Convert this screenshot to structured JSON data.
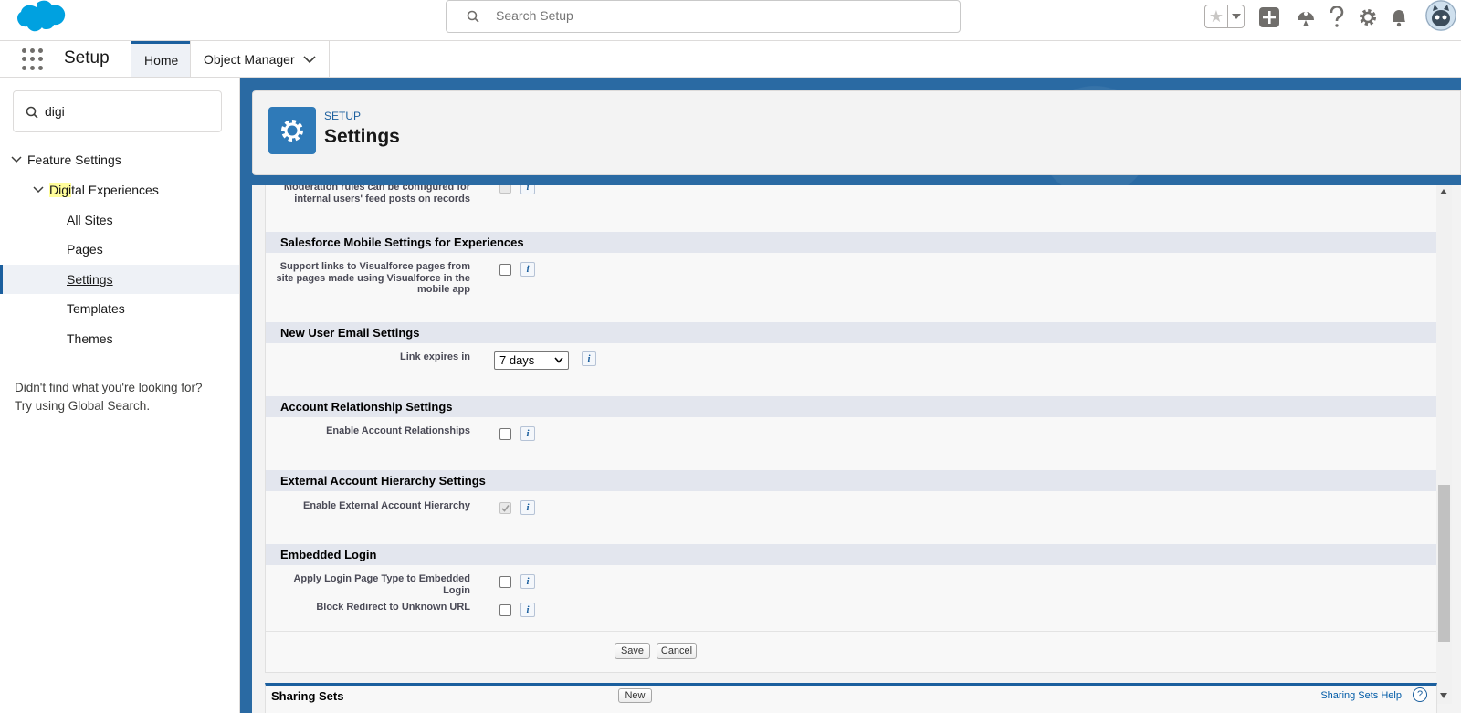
{
  "header": {
    "search_placeholder": "Search Setup"
  },
  "nav": {
    "app_name": "Setup",
    "tabs": [
      {
        "label": "Home",
        "active": true
      },
      {
        "label": "Object Manager",
        "active": false
      }
    ]
  },
  "sidebar": {
    "quickfind_value": "digi",
    "tree": {
      "feature_settings": "Feature Settings",
      "digital_highlight": "Digi",
      "digital_rest": "tal Experiences",
      "children": [
        "All Sites",
        "Pages",
        "Settings",
        "Templates",
        "Themes"
      ],
      "selected": "Settings"
    },
    "help_line1": "Didn't find what you're looking for?",
    "help_line2": "Try using Global Search."
  },
  "page_header": {
    "eyebrow": "SETUP",
    "title": "Settings"
  },
  "form": {
    "moderation_label": "Moderation rules can be configured for internal users' feed posts on records",
    "sections": {
      "mobile": "Salesforce Mobile Settings for Experiences",
      "new_user_email": "New User Email Settings",
      "account_rel": "Account Relationship Settings",
      "ext_hierarchy": "External Account Hierarchy Settings",
      "embedded": "Embedded Login"
    },
    "fields": {
      "support_links": "Support links to Visualforce pages from site pages made using Visualforce in the mobile app",
      "link_expires": "Link expires in",
      "link_expires_value": "7 days",
      "enable_account_rel": "Enable Account Relationships",
      "enable_ext_hierarchy": "Enable External Account Hierarchy",
      "apply_login_page_type": "Apply Login Page Type to Embedded Login",
      "block_redirect": "Block Redirect to Unknown URL"
    },
    "save_label": "Save",
    "cancel_label": "Cancel"
  },
  "sharing_sets": {
    "title": "Sharing Sets",
    "new_label": "New",
    "help_link": "Sharing Sets Help",
    "help_icon": "?"
  },
  "colors": {
    "brand_blue": "#1b5f9e",
    "logo_blue": "#00a1e0",
    "section_header_bg": "#e3e6ee"
  }
}
